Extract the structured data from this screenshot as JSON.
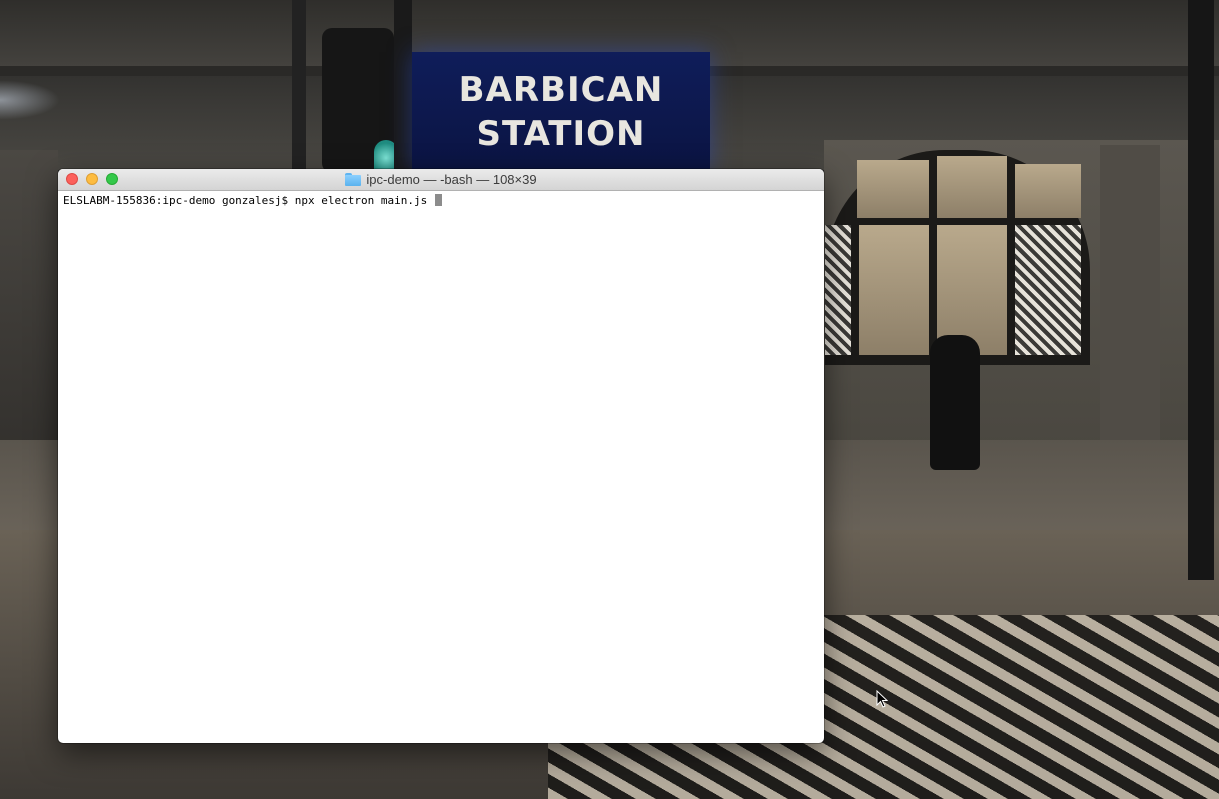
{
  "wallpaper": {
    "sign_line1": "BARBICAN",
    "sign_line2": "STATION"
  },
  "terminal": {
    "folder_icon": "folder-icon",
    "title": "ipc-demo — -bash — 108×39",
    "prompt": "ELSLABM-155836:ipc-demo gonzalesj$ ",
    "command": "npx electron main.js ",
    "traffic_lights": {
      "close_color": "#fc605b",
      "minimize_color": "#fdbc40",
      "zoom_color": "#34c84a"
    }
  },
  "pointer": {
    "icon": "arrow-cursor-icon"
  }
}
